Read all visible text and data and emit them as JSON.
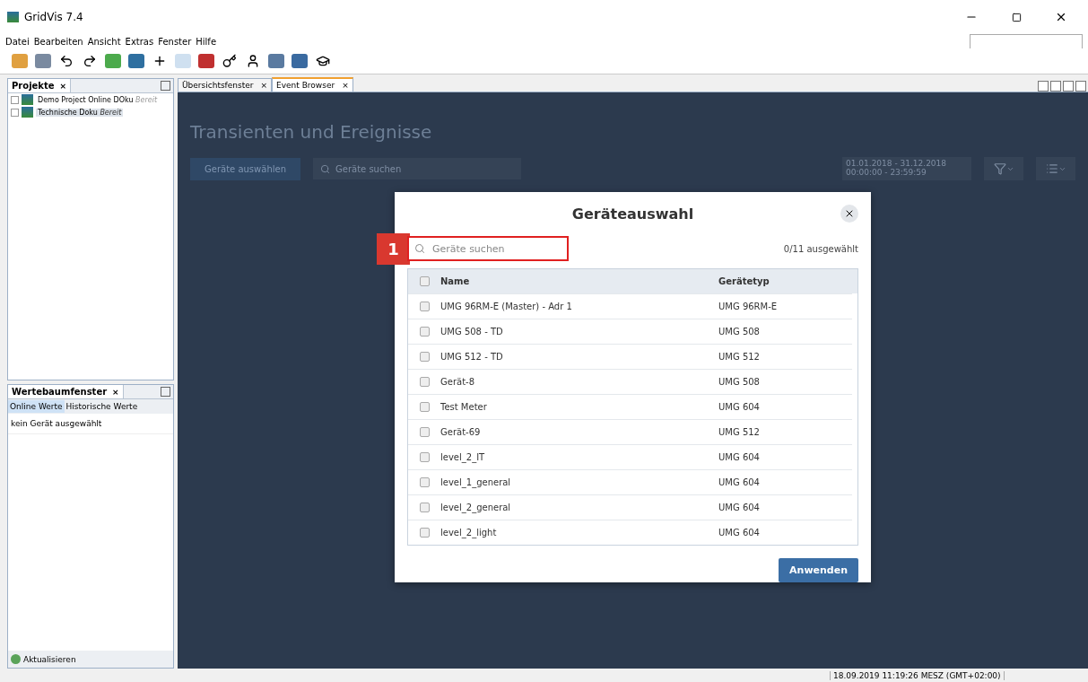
{
  "window": {
    "title": "GridVis 7.4"
  },
  "menu": [
    "Datei",
    "Bearbeiten",
    "Ansicht",
    "Extras",
    "Fenster",
    "Hilfe"
  ],
  "projects_panel": {
    "title": "Projekte",
    "close": "×",
    "items": [
      {
        "name": "Demo Project Online DOku",
        "status": "Bereit",
        "selected": false
      },
      {
        "name": "Technische Doku",
        "status": "Bereit",
        "selected": true
      }
    ]
  },
  "values_panel": {
    "title": "Wertebaumfenster",
    "close": "×",
    "tabs": [
      {
        "label": "Online Werte",
        "selected": true
      },
      {
        "label": "Historische Werte",
        "selected": false
      }
    ],
    "message": "kein Gerät ausgewählt",
    "refresh": "Aktualisieren"
  },
  "editor_tabs": [
    {
      "label": "Übersichtsfenster",
      "close": "×",
      "selected": false
    },
    {
      "label": "Event Browser",
      "close": "×",
      "selected": true
    }
  ],
  "event_browser": {
    "title": "Transienten und Ereignisse",
    "select_button": "Geräte auswählen",
    "search_placeholder": "Geräte suchen",
    "date_range": "01.01.2018 - 31.12.2018",
    "time_range": "00:00:00 - 23:59:59"
  },
  "dialog": {
    "title": "Geräteauswahl",
    "search_placeholder": "Geräte suchen",
    "count": "0/11 ausgewählt",
    "callout": "1",
    "columns": [
      "Name",
      "Gerätetyp"
    ],
    "all_checked": false,
    "rows": [
      {
        "name": "UMG 96RM-E (Master) - Adr 1",
        "type": "UMG 96RM-E",
        "checked": false
      },
      {
        "name": "UMG 508 - TD",
        "type": "UMG 508",
        "checked": false
      },
      {
        "name": "UMG 512 - TD",
        "type": "UMG 512",
        "checked": false
      },
      {
        "name": "Gerät-8",
        "type": "UMG 508",
        "checked": false
      },
      {
        "name": "Test Meter",
        "type": "UMG 604",
        "checked": false
      },
      {
        "name": "Gerät-69",
        "type": "UMG 512",
        "checked": false
      },
      {
        "name": "level_2_IT",
        "type": "UMG 604",
        "checked": false
      },
      {
        "name": "level_1_general",
        "type": "UMG 604",
        "checked": false
      },
      {
        "name": "level_2_general",
        "type": "UMG 604",
        "checked": false
      },
      {
        "name": "level_2_light",
        "type": "UMG 604",
        "checked": false
      }
    ],
    "apply_button": "Anwenden"
  },
  "status_bar": {
    "datetime": "18.09.2019 11:19:26 MESZ (GMT+02:00)"
  }
}
